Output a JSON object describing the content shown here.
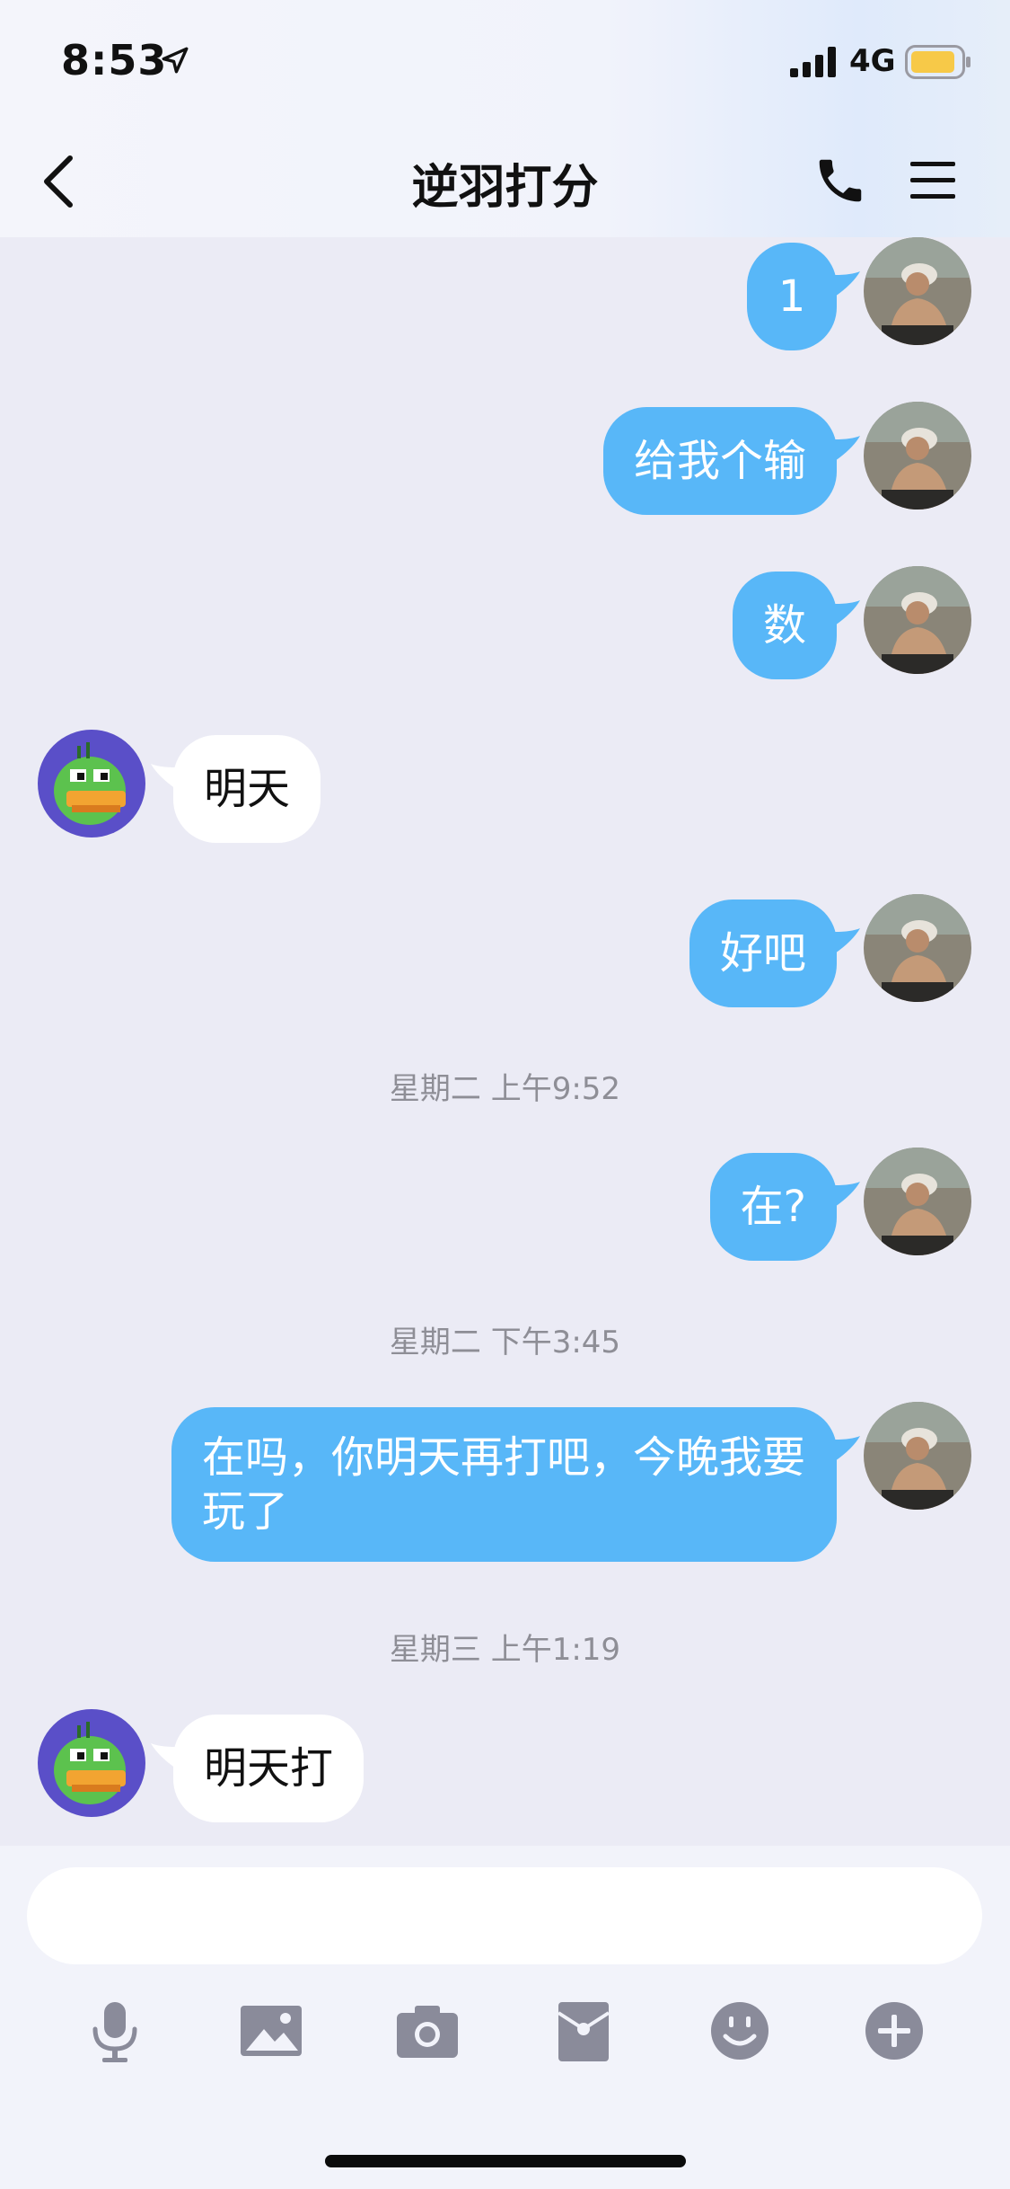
{
  "status_bar": {
    "time": "8:53",
    "network": "4G",
    "icons": [
      "location-arrow-icon",
      "signal-bars-icon",
      "battery-icon"
    ]
  },
  "nav": {
    "title": "逆羽打分",
    "icons": [
      "back-chevron-icon",
      "phone-icon",
      "menu-icon"
    ]
  },
  "messages": [
    {
      "from": "me",
      "text": "1"
    },
    {
      "from": "me",
      "text": "给我个输"
    },
    {
      "from": "me",
      "text": "数"
    },
    {
      "from": "them",
      "text": "明天"
    },
    {
      "from": "me",
      "text": "好吧"
    },
    {
      "type": "timestamp",
      "text": "星期二 上午9:52"
    },
    {
      "from": "me",
      "text": "在?"
    },
    {
      "type": "timestamp",
      "text": "星期二 下午3:45"
    },
    {
      "from": "me",
      "text": "在吗，你明天再打吧，今晚我要玩了"
    },
    {
      "type": "timestamp",
      "text": "星期三 上午1:19"
    },
    {
      "from": "them",
      "text": "明天打"
    }
  ],
  "input": {
    "value": "",
    "placeholder": ""
  },
  "toolbar_icons": [
    "microphone-icon",
    "image-icon",
    "camera-icon",
    "red-packet-icon",
    "emoji-icon",
    "plus-icon"
  ],
  "colors": {
    "background": "#ebebf5",
    "my_bubble": "#58b7f8",
    "their_bubble": "#ffffff",
    "timestamp_text": "#8e8e96",
    "toolbar_icon": "#8a8b9a",
    "battery_fill": "#f7c948"
  }
}
